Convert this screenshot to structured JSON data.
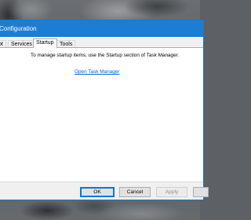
{
  "window": {
    "title": "Configuration"
  },
  "tabs": [
    {
      "label": "ot",
      "active": false
    },
    {
      "label": "Services",
      "active": false
    },
    {
      "label": "Startup",
      "active": true
    },
    {
      "label": "Tools",
      "active": false
    }
  ],
  "startup_panel": {
    "message": "To manage startup items, use the Startup section of Task Manager.",
    "link_label": "Open Task Manager"
  },
  "buttons": {
    "ok": "OK",
    "cancel": "Cancel",
    "apply": "Apply",
    "help": ""
  },
  "colors": {
    "titlebar": "#1b7ed4",
    "link": "#0066cc",
    "default_button_border": "#0078d7"
  }
}
